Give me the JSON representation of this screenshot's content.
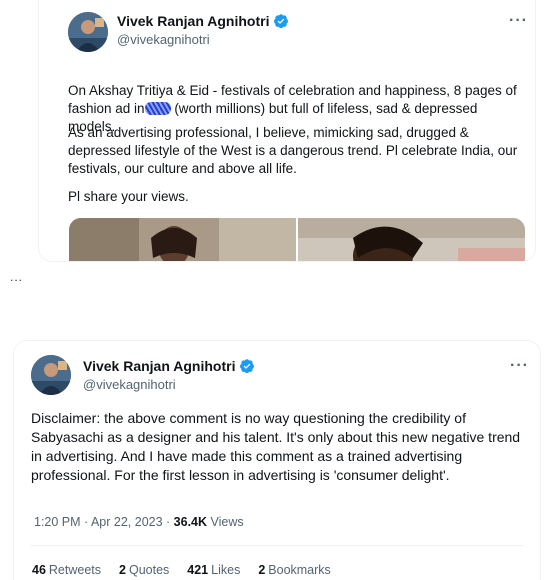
{
  "colors": {
    "verified": "#1d9bf0",
    "secondary_text": "#536471",
    "primary_text": "#0f1419"
  },
  "tweet1": {
    "author": "Vivek Ranjan Agnihotri",
    "handle": "@vivekagnihotri",
    "more": "···",
    "para1_a": "On Akshay Tritiya & Eid - festivals of celebration and happiness, 8 pages of fashion ad in",
    "para1_b": " (worth millions) but full of lifeless, sad & depressed models.",
    "para2": "As an advertising professional, I believe, mimicking sad, drugged & depressed lifestyle of the West is a dangerous trend. Pl celebrate India, our festivals, our culture and above all life.",
    "para3": "Pl share your views."
  },
  "side_ellipsis": "...",
  "tweet2": {
    "author": "Vivek Ranjan Agnihotri",
    "handle": "@vivekagnihotri",
    "more": "···",
    "text": "Disclaimer: the above comment is no way questioning the credibility of Sabyasachi as a designer and his talent. It's only about this new negative trend in advertising. And I have made this comment as a trained advertising professional. For the first lesson in advertising is 'consumer delight'.",
    "time": "1:20 PM · Apr 22, 2023 · ",
    "views_count": "36.4K",
    "views_label": " Views",
    "stats": [
      {
        "count": "46",
        "label": "Retweets"
      },
      {
        "count": "2",
        "label": "Quotes"
      },
      {
        "count": "421",
        "label": "Likes"
      },
      {
        "count": "2",
        "label": "Bookmarks"
      }
    ]
  }
}
